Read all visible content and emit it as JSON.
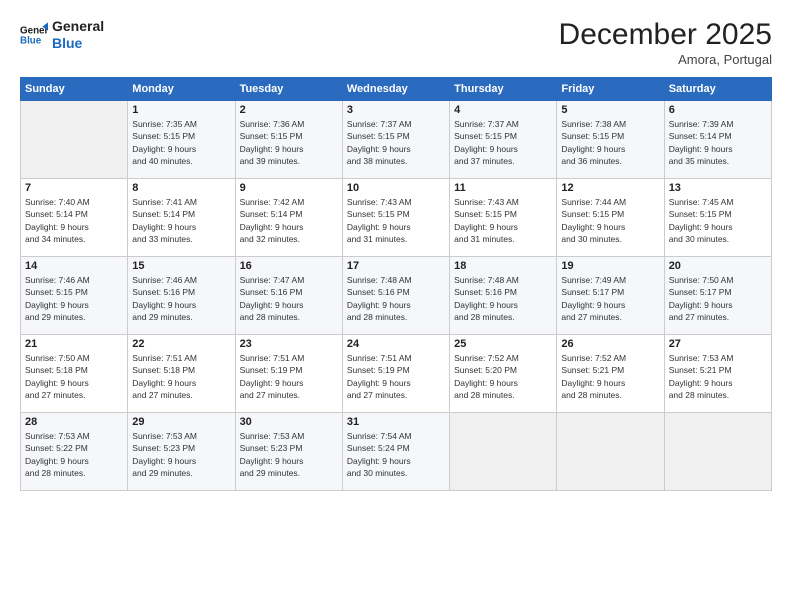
{
  "logo": {
    "line1": "General",
    "line2": "Blue"
  },
  "header": {
    "month": "December 2025",
    "location": "Amora, Portugal"
  },
  "weekdays": [
    "Sunday",
    "Monday",
    "Tuesday",
    "Wednesday",
    "Thursday",
    "Friday",
    "Saturday"
  ],
  "weeks": [
    [
      {
        "day": "",
        "info": ""
      },
      {
        "day": "1",
        "info": "Sunrise: 7:35 AM\nSunset: 5:15 PM\nDaylight: 9 hours\nand 40 minutes."
      },
      {
        "day": "2",
        "info": "Sunrise: 7:36 AM\nSunset: 5:15 PM\nDaylight: 9 hours\nand 39 minutes."
      },
      {
        "day": "3",
        "info": "Sunrise: 7:37 AM\nSunset: 5:15 PM\nDaylight: 9 hours\nand 38 minutes."
      },
      {
        "day": "4",
        "info": "Sunrise: 7:37 AM\nSunset: 5:15 PM\nDaylight: 9 hours\nand 37 minutes."
      },
      {
        "day": "5",
        "info": "Sunrise: 7:38 AM\nSunset: 5:15 PM\nDaylight: 9 hours\nand 36 minutes."
      },
      {
        "day": "6",
        "info": "Sunrise: 7:39 AM\nSunset: 5:14 PM\nDaylight: 9 hours\nand 35 minutes."
      }
    ],
    [
      {
        "day": "7",
        "info": "Sunrise: 7:40 AM\nSunset: 5:14 PM\nDaylight: 9 hours\nand 34 minutes."
      },
      {
        "day": "8",
        "info": "Sunrise: 7:41 AM\nSunset: 5:14 PM\nDaylight: 9 hours\nand 33 minutes."
      },
      {
        "day": "9",
        "info": "Sunrise: 7:42 AM\nSunset: 5:14 PM\nDaylight: 9 hours\nand 32 minutes."
      },
      {
        "day": "10",
        "info": "Sunrise: 7:43 AM\nSunset: 5:15 PM\nDaylight: 9 hours\nand 31 minutes."
      },
      {
        "day": "11",
        "info": "Sunrise: 7:43 AM\nSunset: 5:15 PM\nDaylight: 9 hours\nand 31 minutes."
      },
      {
        "day": "12",
        "info": "Sunrise: 7:44 AM\nSunset: 5:15 PM\nDaylight: 9 hours\nand 30 minutes."
      },
      {
        "day": "13",
        "info": "Sunrise: 7:45 AM\nSunset: 5:15 PM\nDaylight: 9 hours\nand 30 minutes."
      }
    ],
    [
      {
        "day": "14",
        "info": "Sunrise: 7:46 AM\nSunset: 5:15 PM\nDaylight: 9 hours\nand 29 minutes."
      },
      {
        "day": "15",
        "info": "Sunrise: 7:46 AM\nSunset: 5:16 PM\nDaylight: 9 hours\nand 29 minutes."
      },
      {
        "day": "16",
        "info": "Sunrise: 7:47 AM\nSunset: 5:16 PM\nDaylight: 9 hours\nand 28 minutes."
      },
      {
        "day": "17",
        "info": "Sunrise: 7:48 AM\nSunset: 5:16 PM\nDaylight: 9 hours\nand 28 minutes."
      },
      {
        "day": "18",
        "info": "Sunrise: 7:48 AM\nSunset: 5:16 PM\nDaylight: 9 hours\nand 28 minutes."
      },
      {
        "day": "19",
        "info": "Sunrise: 7:49 AM\nSunset: 5:17 PM\nDaylight: 9 hours\nand 27 minutes."
      },
      {
        "day": "20",
        "info": "Sunrise: 7:50 AM\nSunset: 5:17 PM\nDaylight: 9 hours\nand 27 minutes."
      }
    ],
    [
      {
        "day": "21",
        "info": "Sunrise: 7:50 AM\nSunset: 5:18 PM\nDaylight: 9 hours\nand 27 minutes."
      },
      {
        "day": "22",
        "info": "Sunrise: 7:51 AM\nSunset: 5:18 PM\nDaylight: 9 hours\nand 27 minutes."
      },
      {
        "day": "23",
        "info": "Sunrise: 7:51 AM\nSunset: 5:19 PM\nDaylight: 9 hours\nand 27 minutes."
      },
      {
        "day": "24",
        "info": "Sunrise: 7:51 AM\nSunset: 5:19 PM\nDaylight: 9 hours\nand 27 minutes."
      },
      {
        "day": "25",
        "info": "Sunrise: 7:52 AM\nSunset: 5:20 PM\nDaylight: 9 hours\nand 28 minutes."
      },
      {
        "day": "26",
        "info": "Sunrise: 7:52 AM\nSunset: 5:21 PM\nDaylight: 9 hours\nand 28 minutes."
      },
      {
        "day": "27",
        "info": "Sunrise: 7:53 AM\nSunset: 5:21 PM\nDaylight: 9 hours\nand 28 minutes."
      }
    ],
    [
      {
        "day": "28",
        "info": "Sunrise: 7:53 AM\nSunset: 5:22 PM\nDaylight: 9 hours\nand 28 minutes."
      },
      {
        "day": "29",
        "info": "Sunrise: 7:53 AM\nSunset: 5:23 PM\nDaylight: 9 hours\nand 29 minutes."
      },
      {
        "day": "30",
        "info": "Sunrise: 7:53 AM\nSunset: 5:23 PM\nDaylight: 9 hours\nand 29 minutes."
      },
      {
        "day": "31",
        "info": "Sunrise: 7:54 AM\nSunset: 5:24 PM\nDaylight: 9 hours\nand 30 minutes."
      },
      {
        "day": "",
        "info": ""
      },
      {
        "day": "",
        "info": ""
      },
      {
        "day": "",
        "info": ""
      }
    ]
  ]
}
